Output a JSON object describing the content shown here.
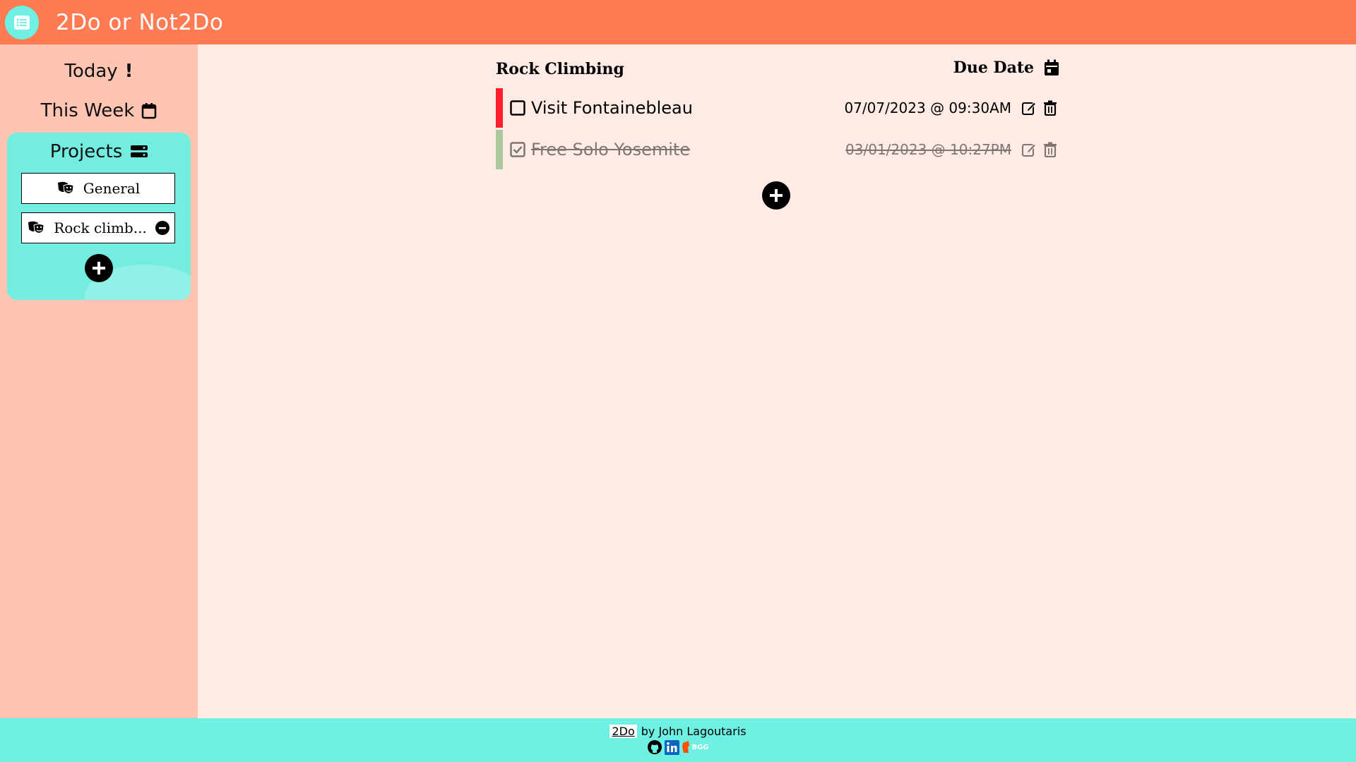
{
  "header": {
    "title": "2Do or Not2Do",
    "logo_icon": "checklist-icon"
  },
  "sidebar": {
    "today_label": "Today",
    "today_icon": "exclamation-icon",
    "week_label": "This Week",
    "week_icon": "calendar-icon",
    "projects_label": "Projects",
    "projects_icon": "server-stack-icon",
    "projects": [
      {
        "label": "General",
        "icon": "theater-masks-icon"
      },
      {
        "label": "Rock climb...",
        "icon": "theater-masks-icon"
      }
    ]
  },
  "main": {
    "title": "Rock Climbing",
    "due_header": "Due Date",
    "tasks": [
      {
        "name": "Visit Fontainebleau",
        "date": "07/07/2023 @ 09:30AM",
        "done": false,
        "priority_color": "#ff1e2d"
      },
      {
        "name": "Free Solo Yosemite",
        "date": "03/01/2023 @ 10:27PM",
        "done": true,
        "priority_color": "#5aa75a"
      }
    ]
  },
  "footer": {
    "brand": "2Do",
    "byline": "by John Lagoutaris",
    "bgg_label": "BGG",
    "icons": [
      "github-icon",
      "linkedin-icon",
      "bgg-icon"
    ]
  },
  "colors": {
    "header": "#ff7b54",
    "sidebar": "#ffc5b2",
    "main": "#ffebe5",
    "accent": "#6ef0e2"
  }
}
